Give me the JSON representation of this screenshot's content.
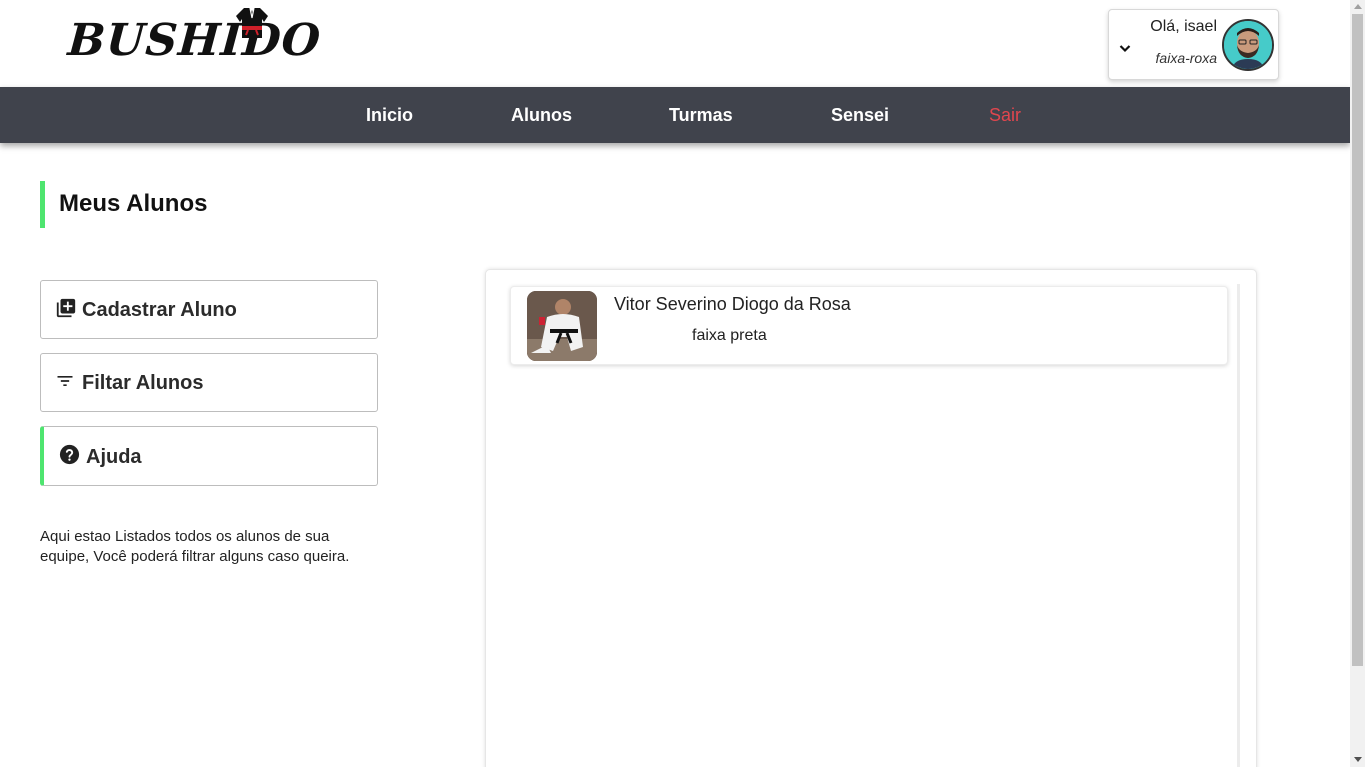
{
  "brand": {
    "name": "Bushido"
  },
  "user": {
    "greeting": "Olá, isael",
    "belt": "faixa-roxa"
  },
  "nav": {
    "items": [
      {
        "label": "Inicio"
      },
      {
        "label": "Alunos"
      },
      {
        "label": "Turmas"
      },
      {
        "label": "Sensei"
      },
      {
        "label": "Sair"
      }
    ]
  },
  "page": {
    "title": "Meus Alunos"
  },
  "sidebar": {
    "buttons": [
      {
        "label": "Cadastrar Aluno",
        "icon": "add-box-icon"
      },
      {
        "label": "Filtar Alunos",
        "icon": "filter-icon"
      },
      {
        "label": "Ajuda",
        "icon": "help-icon"
      }
    ],
    "help_text": "Aqui estao Listados todos os alunos de sua equipe, Você poderá filtrar alguns caso queira."
  },
  "students": [
    {
      "name": "Vitor Severino Diogo da Rosa",
      "belt": "faixa preta"
    }
  ],
  "colors": {
    "accent": "#4ee56f",
    "nav_bg": "#40434c",
    "logout": "#e0464e"
  }
}
